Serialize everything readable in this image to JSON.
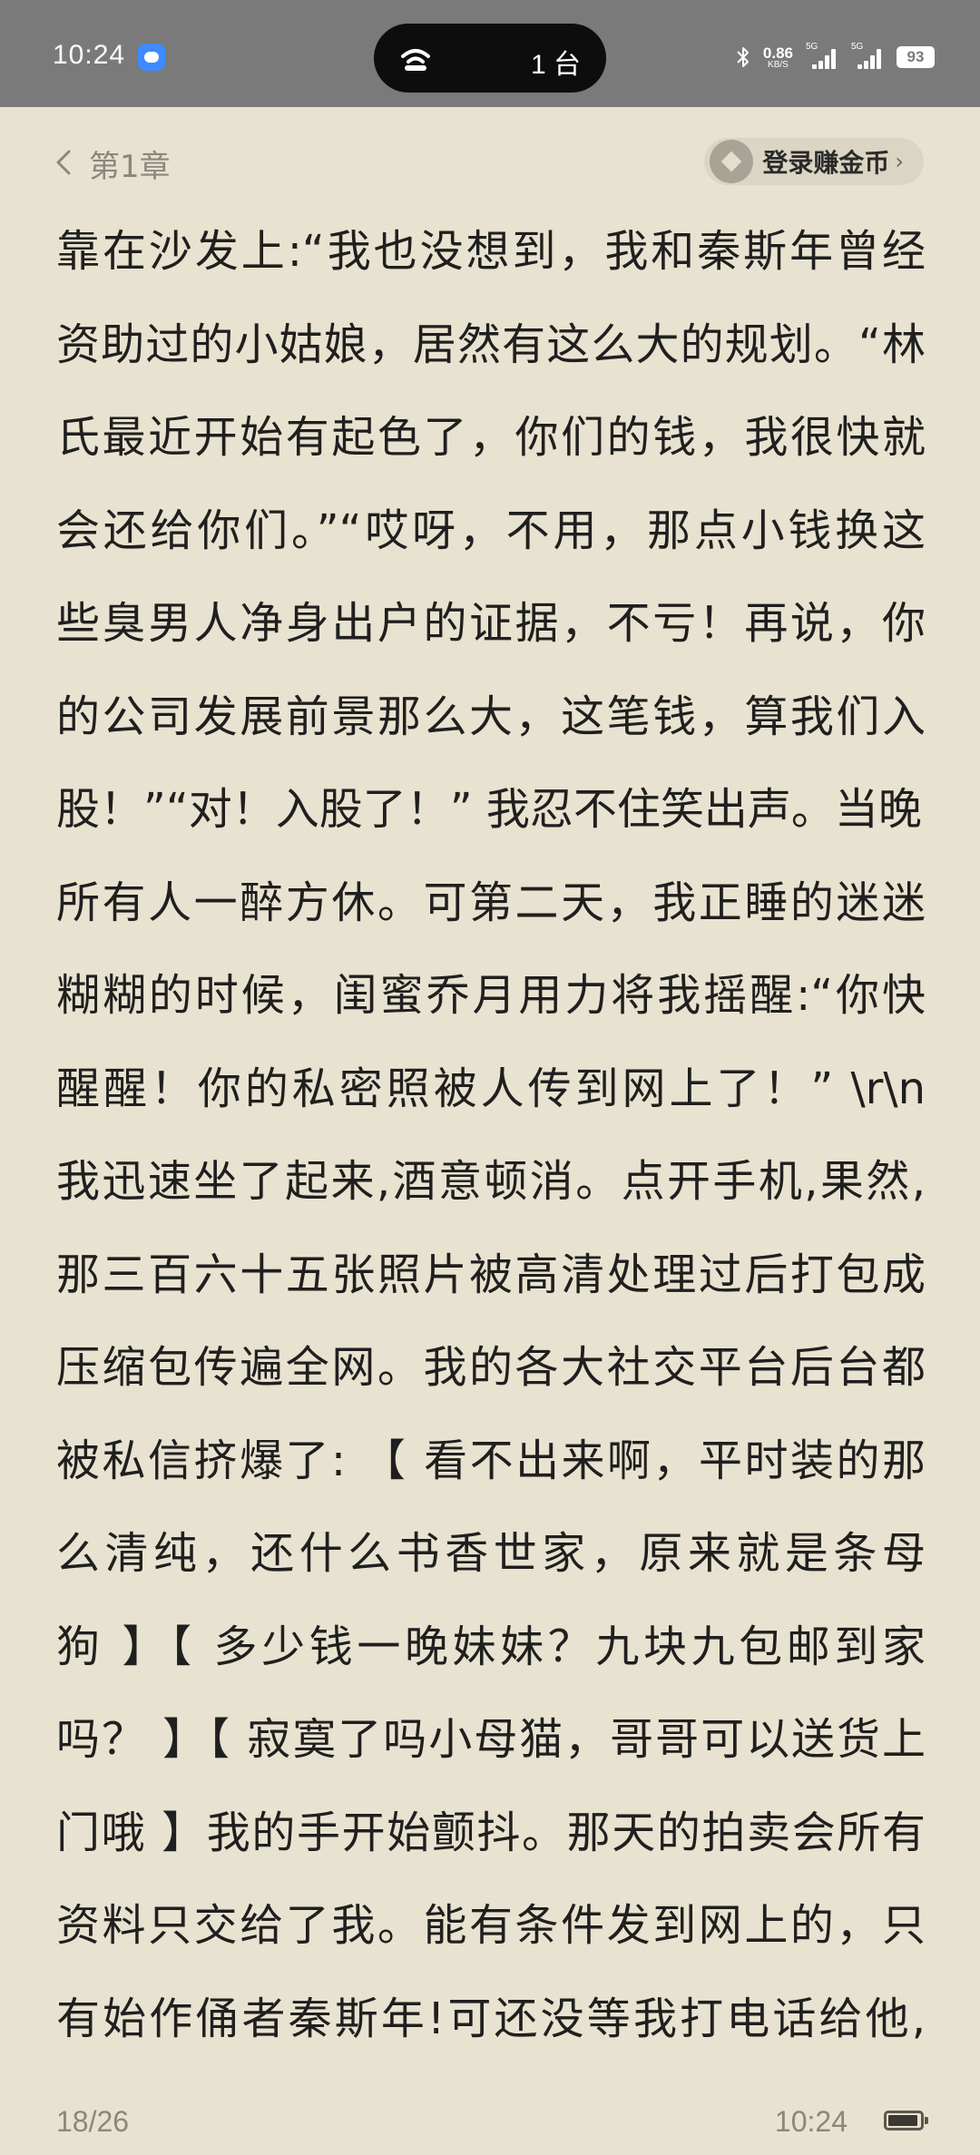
{
  "status_bar": {
    "time": "10:24",
    "island_text": "1 台",
    "net_speed_value": "0.86",
    "net_speed_unit": "KB/S",
    "sim1_label": "5G",
    "sim2_label": "5G",
    "battery": "93"
  },
  "header": {
    "chapter_title": "第1章",
    "coin_label": "登录赚金币",
    "coin_chevron": "›"
  },
  "body": {
    "lines": [
      "靠在沙发上:“我也没想到，我和秦斯年曾经",
      "资助过的小姑娘，居然有这么大的规划。“林",
      "氏最近开始有起色了，你们的钱，我很快就",
      "会还给你们。”“哎呀，不用，那点小钱换这",
      "些臭男人净身出户的证据，不亏！再说，你",
      "的公司发展前景那么大，这笔钱，算我们入",
      "股！”“对！入股了！” 我忍不住笑出声。当晚，",
      "所有人一醉方休。可第二天，我正睡的迷迷",
      "糊糊的时候，闺蜜乔月用力将我摇醒:“你快",
      "醒醒！你的私密照被人传到网上了！” \\r\\n",
      "我迅速坐了起来,酒意顿消。点开手机,果然,",
      "那三百六十五张照片被高清处理过后打包成",
      "压缩包传遍全网。我的各大社交平台后台都",
      "被私信挤爆了: 【 看不出来啊，平时装的那",
      "么清纯，还什么书香世家，原来就是条母",
      "狗 】【 多少钱一晚妹妹？九块九包邮到家",
      "吗？ 】【 寂寞了吗小母猫，哥哥可以送货上",
      "门哦 】我的手开始颤抖。那天的拍卖会所有",
      "资料只交给了我。能有条件发到网上的，只",
      "有始作俑者秦斯年!可还没等我打电话给他,"
    ]
  },
  "footer": {
    "page_indicator": "18/26",
    "time": "10:24",
    "battery_level": 0.93
  },
  "colors": {
    "page_background": "#e8e2d0",
    "status_bar": "#7a7a7a",
    "body_text": "#1f1f1f",
    "muted_text": "#8c877c",
    "pill_background": "#dbd5c3"
  }
}
